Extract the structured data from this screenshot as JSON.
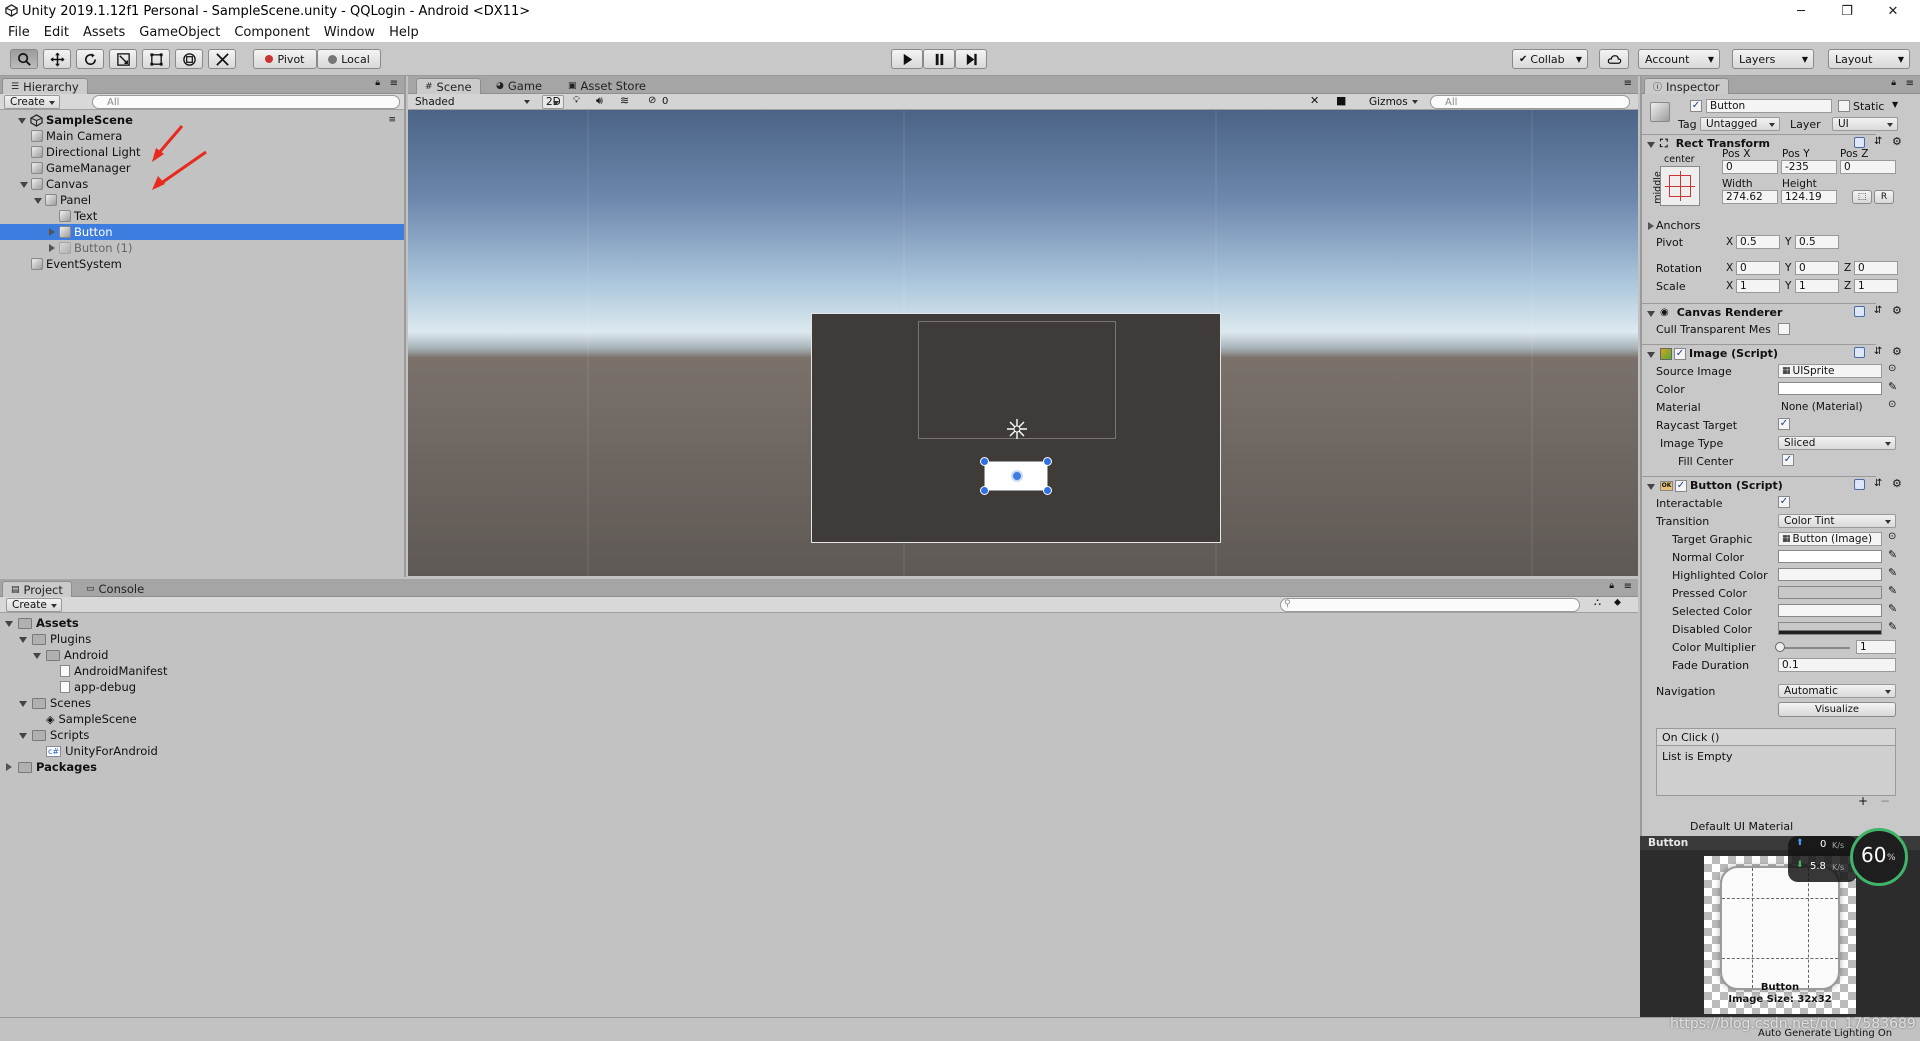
{
  "window": {
    "title": "Unity 2019.1.12f1 Personal - SampleScene.unity - QQLogin - Android <DX11>",
    "minimize": "─",
    "maximize": "❐",
    "close": "✕"
  },
  "menu": [
    "File",
    "Edit",
    "Assets",
    "GameObject",
    "Component",
    "Window",
    "Help"
  ],
  "toolbar": {
    "pivot": "Pivot",
    "local": "Local",
    "collab": "Collab",
    "account": "Account",
    "layers": "Layers",
    "layout": "Layout"
  },
  "hierarchy": {
    "tab": "Hierarchy",
    "create": "Create",
    "search_placeholder": "All",
    "scene": "SampleScene",
    "items": [
      {
        "label": "Main Camera",
        "depth": 1,
        "fold": "none",
        "selected": false,
        "dim": false
      },
      {
        "label": "Directional Light",
        "depth": 1,
        "fold": "none",
        "selected": false,
        "dim": false
      },
      {
        "label": "GameManager",
        "depth": 1,
        "fold": "none",
        "selected": false,
        "dim": false
      },
      {
        "label": "Canvas",
        "depth": 1,
        "fold": "open",
        "selected": false,
        "dim": false
      },
      {
        "label": "Panel",
        "depth": 2,
        "fold": "open",
        "selected": false,
        "dim": false
      },
      {
        "label": "Text",
        "depth": 3,
        "fold": "none",
        "selected": false,
        "dim": false
      },
      {
        "label": "Button",
        "depth": 3,
        "fold": "closed",
        "selected": true,
        "dim": false
      },
      {
        "label": "Button (1)",
        "depth": 3,
        "fold": "closed",
        "selected": false,
        "dim": true
      },
      {
        "label": "EventSystem",
        "depth": 1,
        "fold": "none",
        "selected": false,
        "dim": false
      }
    ]
  },
  "scene": {
    "tabs": [
      "Scene",
      "Game",
      "Asset Store"
    ],
    "shading": "Shaded",
    "mode2d": "2D",
    "fx_count": "0",
    "gizmos": "Gizmos",
    "search_placeholder": "All"
  },
  "project": {
    "tabs": [
      "Project",
      "Console"
    ],
    "create": "Create",
    "items": [
      {
        "label": "Assets",
        "depth": 0,
        "fold": "open",
        "kind": "folder",
        "bold": true
      },
      {
        "label": "Plugins",
        "depth": 1,
        "fold": "open",
        "kind": "folder",
        "bold": false
      },
      {
        "label": "Android",
        "depth": 2,
        "fold": "open",
        "kind": "folder",
        "bold": false
      },
      {
        "label": "AndroidManifest",
        "depth": 3,
        "fold": "none",
        "kind": "file",
        "bold": false
      },
      {
        "label": "app-debug",
        "depth": 3,
        "fold": "none",
        "kind": "file",
        "bold": false
      },
      {
        "label": "Scenes",
        "depth": 1,
        "fold": "open",
        "kind": "folder",
        "bold": false
      },
      {
        "label": "SampleScene",
        "depth": 2,
        "fold": "none",
        "kind": "unity",
        "bold": false
      },
      {
        "label": "Scripts",
        "depth": 1,
        "fold": "open",
        "kind": "folder",
        "bold": false
      },
      {
        "label": "UnityForAndroid",
        "depth": 2,
        "fold": "none",
        "kind": "cs",
        "bold": false
      },
      {
        "label": "Packages",
        "depth": 0,
        "fold": "closed",
        "kind": "folder",
        "bold": true
      }
    ]
  },
  "inspector": {
    "tab": "Inspector",
    "object_name": "Button",
    "static_label": "Static",
    "tag_label": "Tag",
    "tag_value": "Untagged",
    "layer_label": "Layer",
    "layer_value": "UI",
    "rect": {
      "title": "Rect Transform",
      "anchor_h": "center",
      "anchor_v": "middle",
      "posx_label": "Pos X",
      "posy_label": "Pos Y",
      "posz_label": "Pos Z",
      "posx": "0",
      "posy": "-235",
      "posz": "0",
      "width_label": "Width",
      "height_label": "Height",
      "width": "274.62",
      "height": "124.19",
      "r_btn": "R",
      "anchors": "Anchors",
      "pivot": "Pivot",
      "pivot_x": "0.5",
      "pivot_y": "0.5",
      "rotation": "Rotation",
      "rot_x": "0",
      "rot_y": "0",
      "rot_z": "0",
      "scale": "Scale",
      "scale_x": "1",
      "scale_y": "1",
      "scale_z": "1",
      "x": "X",
      "y": "Y",
      "z": "Z"
    },
    "canvas_renderer": {
      "title": "Canvas Renderer",
      "cull": "Cull Transparent Mes"
    },
    "image": {
      "title": "Image (Script)",
      "source_image_label": "Source Image",
      "source_image": "UISprite",
      "color_label": "Color",
      "material_label": "Material",
      "material": "None (Material)",
      "raycast_label": "Raycast Target",
      "image_type_label": "Image Type",
      "image_type": "Sliced",
      "fill_center_label": "Fill Center"
    },
    "button": {
      "title": "Button (Script)",
      "interactable": "Interactable",
      "transition_label": "Transition",
      "transition": "Color Tint",
      "target_graphic_label": "Target Graphic",
      "target_graphic": "Button (Image)",
      "normal": "Normal Color",
      "highlighted": "Highlighted Color",
      "pressed": "Pressed Color",
      "selected": "Selected Color",
      "disabled": "Disabled Color",
      "multiplier_label": "Color Multiplier",
      "multiplier": "1",
      "fade_label": "Fade Duration",
      "fade": "0.1",
      "navigation_label": "Navigation",
      "navigation": "Automatic",
      "visualize": "Visualize",
      "onclick": "On Click ()",
      "list_empty": "List is Empty",
      "plus": "+",
      "minus": "−"
    },
    "material_row": "Default UI Material",
    "preview": {
      "title": "Button",
      "caption_name": "Button",
      "caption_size": "Image Size: 32x32"
    },
    "net": {
      "up": "0",
      "up_unit": "K/s",
      "down": "5.8",
      "down_unit": "K/s",
      "percent": "60",
      "percent_unit": "%"
    }
  },
  "status": {
    "url": "https://blog.csdn.net/qq_17583689",
    "lighting": "Auto Generate Lighting On"
  },
  "colors": {
    "selection": "#3e7de0",
    "sky_top": "#4b6486",
    "horizon": "#dce9ef",
    "ground": "#5f5955",
    "panel": "#3f3b38"
  }
}
